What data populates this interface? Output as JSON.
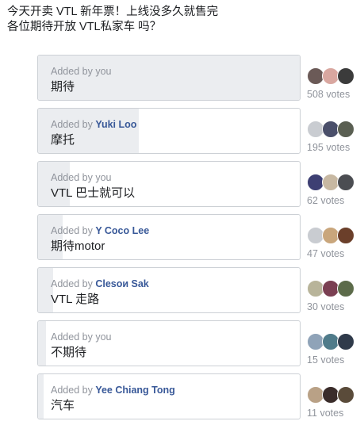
{
  "question": {
    "line1": "今天开卖 VTL 新年票！上线没多久就售完",
    "line2": "各位期待开放 VTL私家车 吗？"
  },
  "options": [
    {
      "added_prefix": "Added by",
      "added_name": "you",
      "added_name_is_link": false,
      "label": "期待",
      "votes_text": "508 votes",
      "vote_share": 1.0,
      "voter_avatars": [
        "#6b5a57",
        "#d9a7a0",
        "#3b3b3b"
      ]
    },
    {
      "added_prefix": "Added by",
      "added_name": "Yuki Loo",
      "added_name_is_link": true,
      "label": "摩托",
      "votes_text": "195 votes",
      "vote_share": 0.384,
      "voter_avatars": [
        "#c9ccd1",
        "#4a4f6a",
        "#5a5f52"
      ]
    },
    {
      "added_prefix": "Added by",
      "added_name": "you",
      "added_name_is_link": false,
      "label": "VTL 巴士就可以",
      "votes_text": "62 votes",
      "vote_share": 0.122,
      "voter_avatars": [
        "#3d3f73",
        "#c7b8a2",
        "#4b4d52"
      ]
    },
    {
      "added_prefix": "Added by",
      "added_name": "Y Coco Lee",
      "added_name_is_link": true,
      "label": "期待motor",
      "votes_text": "47 votes",
      "vote_share": 0.093,
      "voter_avatars": [
        "#c9ccd1",
        "#c9a67c",
        "#6b3f2a"
      ]
    },
    {
      "added_prefix": "Added by",
      "added_name": "Clesoи Sak",
      "added_name_is_link": true,
      "label": "VTL 走路",
      "votes_text": "30 votes",
      "vote_share": 0.059,
      "voter_avatars": [
        "#b8b49a",
        "#7a3f52",
        "#5c6b4a"
      ]
    },
    {
      "added_prefix": "Added by",
      "added_name": "you",
      "added_name_is_link": false,
      "label": "不期待",
      "votes_text": "15 votes",
      "vote_share": 0.03,
      "voter_avatars": [
        "#8fa3b8",
        "#4f7b8a",
        "#2f3a4a"
      ]
    },
    {
      "added_prefix": "Added by",
      "added_name": "Yee Chiang Tong",
      "added_name_is_link": true,
      "label": "汽车",
      "votes_text": "11 votes",
      "vote_share": 0.022,
      "voter_avatars": [
        "#b9a186",
        "#3a2c2a",
        "#5a4b3a"
      ]
    }
  ],
  "colors": {
    "link": "#385898",
    "muted": "#90949c",
    "bar_fill": "#ebedf0",
    "border": "#ccd0d5"
  }
}
